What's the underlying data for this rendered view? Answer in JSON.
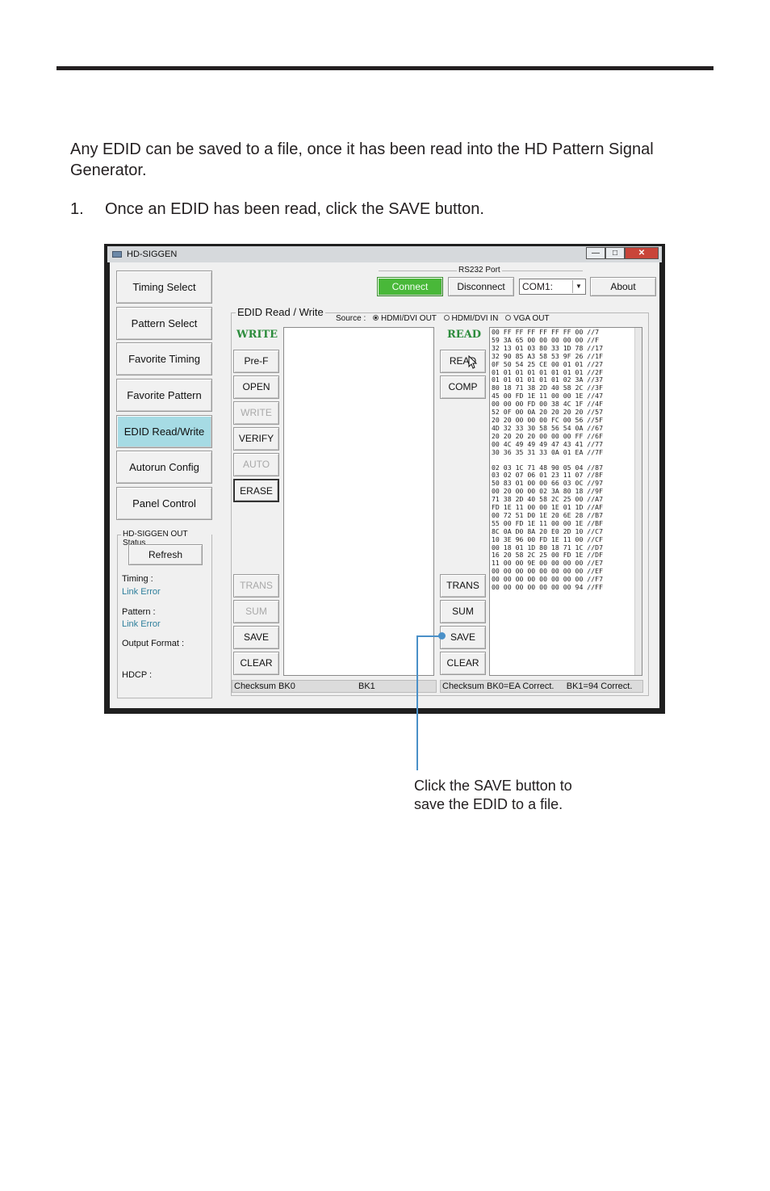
{
  "intro": "Any EDID can be saved to a file, once it has been read into the HD Pattern Signal Generator.",
  "step": {
    "number": "1.",
    "text": "Once an EDID has been read, click the SAVE button."
  },
  "window": {
    "title": "HD-SIGGEN",
    "controls": {
      "minimize": "—",
      "maximize": "□",
      "close": "✕"
    }
  },
  "nav": [
    "Timing Select",
    "Pattern Select",
    "Favorite Timing",
    "Favorite Pattern",
    "EDID Read/Write",
    "Autorun Config",
    "Panel Control"
  ],
  "status_group": {
    "title": "HD-SIGGEN OUT Status",
    "refresh": "Refresh",
    "timing_label": "Timing :",
    "timing_value": "Link Error",
    "pattern_label": "Pattern :",
    "pattern_value": "Link Error",
    "output_format_label": "Output Format :",
    "hdcp_label": "HDCP :"
  },
  "rs232": {
    "title": "RS232 Port",
    "connect": "Connect",
    "disconnect": "Disconnect",
    "port": "COM1:",
    "about": "About"
  },
  "edid": {
    "title": "EDID Read / Write",
    "source_label": "Source :",
    "sources": [
      "HDMI/DVI OUT",
      "HDMI/DVI IN",
      "VGA OUT"
    ],
    "write_heading": "WRITE",
    "read_heading": "READ",
    "write_buttons": {
      "pref": "Pre-F",
      "open": "OPEN",
      "write": "WRITE",
      "verify": "VERIFY",
      "auto": "AUTO",
      "erase": "ERASE",
      "trans": "TRANS",
      "sum": "SUM",
      "save": "SAVE",
      "clear": "CLEAR"
    },
    "read_buttons": {
      "read": "READ",
      "comp": "COMP",
      "trans": "TRANS",
      "sum": "SUM",
      "save": "SAVE",
      "clear": "CLEAR"
    },
    "status_left_bk0": "Checksum BK0",
    "status_left_bk1": "BK1",
    "status_right": "Checksum BK0=EA Correct.     BK1=94 Correct."
  },
  "hex_block0": [
    "00 FF FF FF FF FF FF 00 //7",
    "59 3A 65 00 00 00 00 00 //F",
    "32 13 01 03 80 33 1D 78 //17",
    "32 90 85 A3 58 53 9F 26 //1F",
    "0F 50 54 25 CE 00 01 01 //27",
    "01 01 01 01 01 01 01 01 //2F",
    "01 01 01 01 01 01 02 3A //37",
    "80 18 71 38 2D 40 58 2C //3F",
    "45 00 FD 1E 11 00 00 1E //47",
    "00 00 00 FD 00 38 4C 1F //4F",
    "52 0F 00 0A 20 20 20 20 //57",
    "20 20 00 00 00 FC 00 56 //5F",
    "4D 32 33 30 58 56 54 0A //67",
    "20 20 20 20 00 00 00 FF //6F",
    "00 4C 49 49 49 47 43 41 //77",
    "30 36 35 31 33 0A 01 EA //7F"
  ],
  "hex_block1": [
    "02 03 1C 71 48 90 05 04 //87",
    "03 02 07 06 01 23 11 07 //8F",
    "50 83 01 00 00 66 03 0C //97",
    "00 20 00 00 02 3A 80 18 //9F",
    "71 38 2D 40 58 2C 25 00 //A7",
    "FD 1E 11 00 00 1E 01 1D //AF",
    "00 72 51 D0 1E 20 6E 28 //B7",
    "55 00 FD 1E 11 00 00 1E //BF",
    "8C 0A D0 8A 20 E0 2D 10 //C7",
    "10 3E 96 00 FD 1E 11 00 //CF",
    "00 18 01 1D 80 18 71 1C //D7",
    "16 20 58 2C 25 00 FD 1E //DF",
    "11 00 00 9E 00 00 00 00 //E7",
    "00 00 00 00 00 00 00 00 //EF",
    "00 00 00 00 00 00 00 00 //F7",
    "00 00 00 00 00 00 00 94 //FF"
  ],
  "callout": "Click the SAVE button to save the EDID to a file."
}
